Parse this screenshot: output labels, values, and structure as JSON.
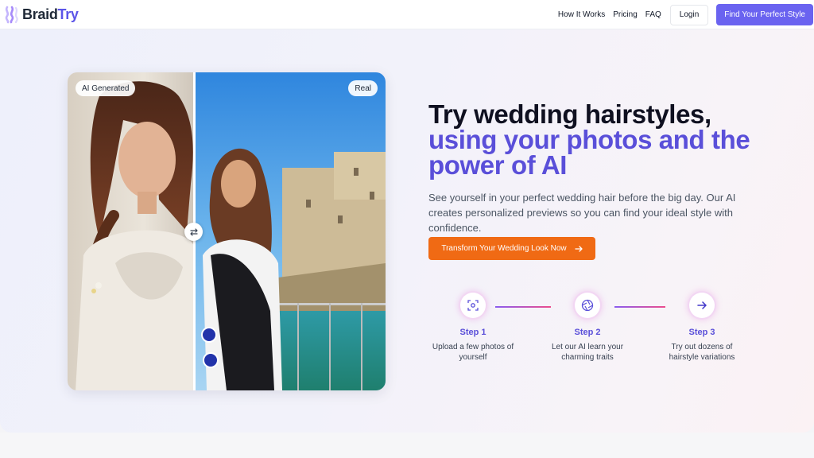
{
  "brand": {
    "name_part1": "Braid",
    "name_part2": "Try",
    "logo_icon": "braid-logo-icon"
  },
  "nav": {
    "links": [
      "How It Works",
      "Pricing",
      "FAQ"
    ],
    "login_label": "Login",
    "cta_label": "Find Your Perfect Style"
  },
  "compare": {
    "left_badge": "AI Generated",
    "right_badge": "Real",
    "handle_icon": "swap-arrows-icon"
  },
  "hero": {
    "headline_line1": "Try wedding hairstyles,",
    "headline_accent": "using your photos and the power of AI",
    "subtext": "See yourself in your perfect wedding hair before the big day. Our AI creates personalized previews so you can find your ideal style with confidence.",
    "cta_label": "Transform Your Wedding Look Now",
    "cta_icon": "arrow-right-icon"
  },
  "steps": [
    {
      "title": "Step 1",
      "desc": "Upload a few photos of yourself",
      "icon": "scan-face-icon"
    },
    {
      "title": "Step 2",
      "desc": "Let our AI learn your charming traits",
      "icon": "aperture-icon"
    },
    {
      "title": "Step 3",
      "desc": "Try out dozens of hairstyle variations",
      "icon": "arrow-right-icon"
    }
  ],
  "colors": {
    "accent": "#5b54e8",
    "cta_orange": "#f06a14",
    "nav_cta": "#6a63f0"
  }
}
